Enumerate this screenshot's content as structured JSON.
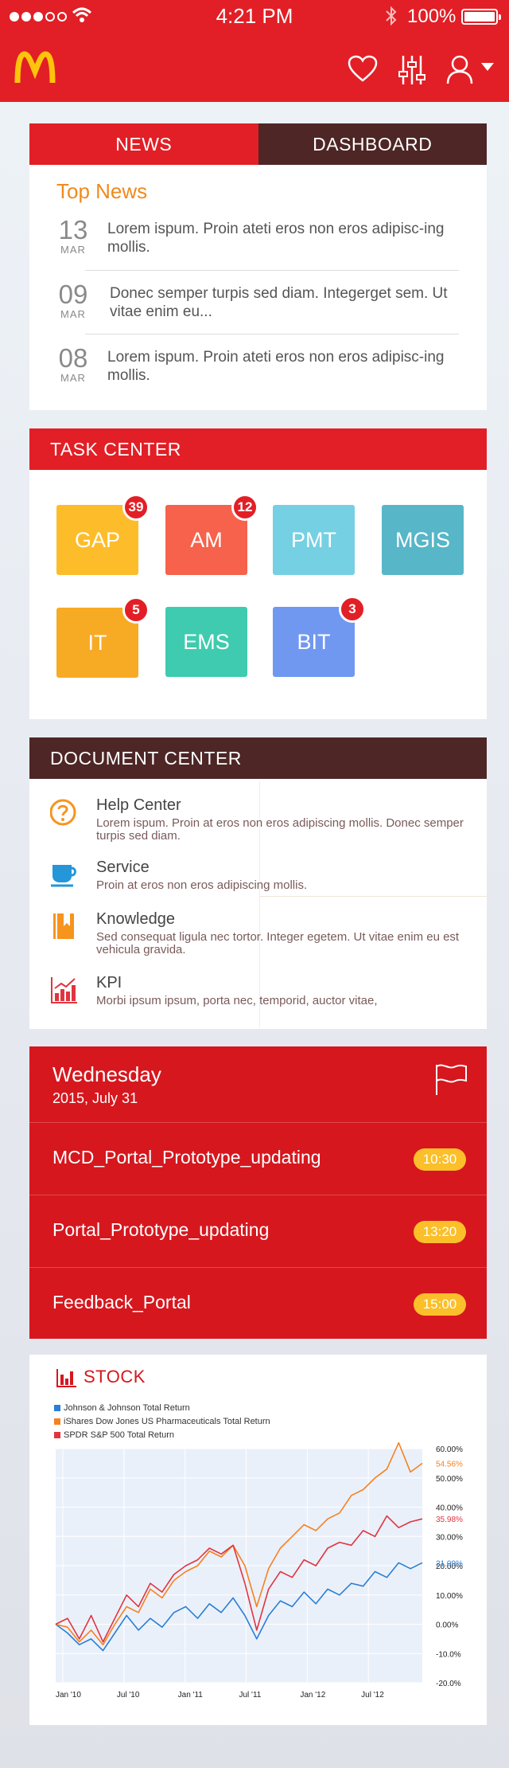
{
  "status_bar": {
    "time": "4:21 PM",
    "battery": "100%"
  },
  "header": {
    "logo": "mcdonalds-logo",
    "icons": [
      "heart-icon",
      "sliders-icon",
      "user-icon",
      "caret-down-icon"
    ]
  },
  "news_card": {
    "tabs": [
      {
        "label": "NEWS",
        "active": true
      },
      {
        "label": "DASHBOARD",
        "active": false
      }
    ],
    "title": "Top News",
    "items": [
      {
        "day": "13",
        "month": "MAR",
        "text": "Lorem ispum. Proin ateti eros non eros adipisc-ing mollis."
      },
      {
        "day": "09",
        "month": "MAR",
        "text": "Donec semper turpis sed diam. Integerget sem. Ut vitae enim eu..."
      },
      {
        "day": "08",
        "month": "MAR",
        "text": "Lorem ispum. Proin ateti eros non eros adipisc-ing mollis."
      }
    ]
  },
  "task_center": {
    "title": "TASK CENTER",
    "tiles": [
      {
        "label": "GAP",
        "badge": "39",
        "color": "#fdbd2b"
      },
      {
        "label": "AM",
        "badge": "12",
        "color": "#f6624b"
      },
      {
        "label": "PMT",
        "badge": "",
        "color": "#76d0e3"
      },
      {
        "label": "MGIS",
        "badge": "",
        "color": "#57b6c8"
      },
      {
        "label": "IT",
        "badge": "5",
        "color": "#f7ab24"
      },
      {
        "label": "EMS",
        "badge": "",
        "color": "#3fcbaf"
      },
      {
        "label": "BIT",
        "badge": "3",
        "color": "#7198f0"
      }
    ]
  },
  "document_center": {
    "title": "DOCUMENT CENTER",
    "items": [
      {
        "icon": "help-circle-icon",
        "title": "Help Center",
        "desc": "Lorem ispum. Proin at eros non eros adipiscing mollis. Donec semper turpis sed diam."
      },
      {
        "icon": "coffee-cup-icon",
        "title": "Service",
        "desc": "Proin at eros non eros adipiscing mollis."
      },
      {
        "icon": "book-icon",
        "title": "Knowledge",
        "desc": "Sed consequat ligula nec tortor. Integer egetem. Ut vitae enim eu est vehicula gravida."
      },
      {
        "icon": "kpi-chart-icon",
        "title": "KPI",
        "desc": "Morbi ipsum ipsum, porta nec, temporid, auctor vitae,"
      }
    ]
  },
  "schedule": {
    "day": "Wednesday",
    "date": "2015, July 31",
    "items": [
      {
        "label": "MCD_Portal_Prototype_updating",
        "time": "10:30"
      },
      {
        "label": "Portal_Prototype_updating",
        "time": "13:20"
      },
      {
        "label": "Feedback_Portal",
        "time": "15:00"
      }
    ]
  },
  "stock": {
    "title": "STOCK"
  },
  "chart_data": {
    "type": "line",
    "title": "",
    "x": [
      "Jan '10",
      "Jul '10",
      "Jan '11",
      "Jul '11",
      "Jan '12",
      "Jul '12"
    ],
    "ylim": [
      -20,
      60
    ],
    "yticks": [
      "60.00%",
      "50.00%",
      "40.00%",
      "30.00%",
      "20.00%",
      "10.00%",
      "0.00%",
      "-10.0%",
      "-20.0%"
    ],
    "series": [
      {
        "name": "Johnson & Johnson Total Return",
        "color": "#2a7fd4",
        "end_label": "21.09%",
        "values": [
          0,
          -3,
          -7,
          -5,
          -9,
          -3,
          3,
          -2,
          2,
          -1,
          4,
          6,
          2,
          7,
          4,
          9,
          3,
          -5,
          3,
          8,
          6,
          11,
          7,
          12,
          10,
          14,
          13,
          18,
          16,
          21,
          19,
          21
        ]
      },
      {
        "name": "iShares Dow Jones US Pharmaceuticals Total Return",
        "color": "#f58220",
        "end_label": "54.56%",
        "values": [
          0,
          -1,
          -6,
          -2,
          -7,
          0,
          6,
          4,
          12,
          9,
          15,
          18,
          20,
          25,
          23,
          27,
          20,
          6,
          19,
          26,
          30,
          34,
          32,
          36,
          38,
          44,
          46,
          50,
          53,
          62,
          52,
          55
        ]
      },
      {
        "name": "SPDR S&P 500 Total Return",
        "color": "#e0353f",
        "end_label": "35.98%",
        "values": [
          0,
          2,
          -5,
          3,
          -6,
          2,
          10,
          6,
          14,
          11,
          17,
          20,
          22,
          26,
          24,
          27,
          14,
          -2,
          12,
          18,
          16,
          22,
          20,
          26,
          28,
          27,
          32,
          30,
          37,
          33,
          35,
          36
        ]
      }
    ]
  }
}
